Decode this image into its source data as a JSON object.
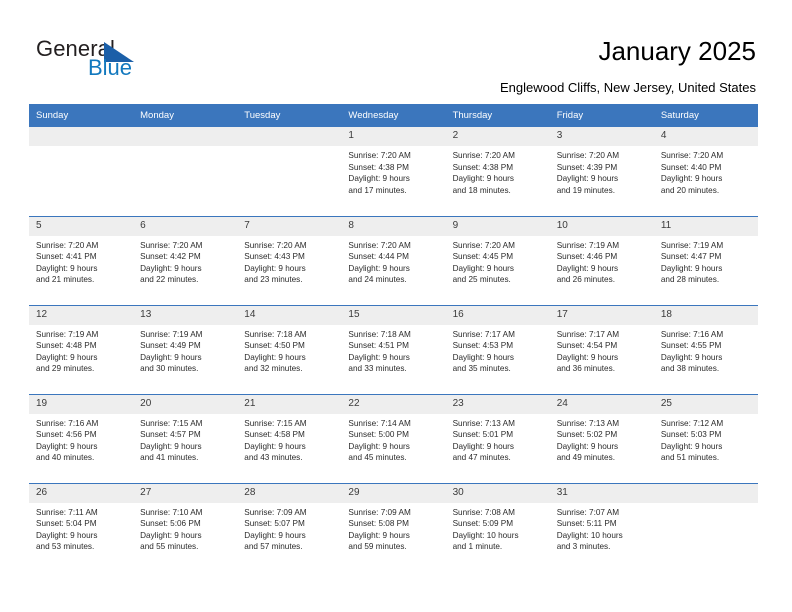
{
  "brand": {
    "name_top": "General",
    "name_bottom": "Blue",
    "accent_blue": "#1278be",
    "triangle_blue": "#1b5fa8"
  },
  "header": {
    "title": "January 2025",
    "subtitle": "Englewood Cliffs, New Jersey, United States"
  },
  "calendar": {
    "header_bg": "#3b76bd",
    "daynum_bg": "#eeeeee",
    "weekday_headers": [
      "Sunday",
      "Monday",
      "Tuesday",
      "Wednesday",
      "Thursday",
      "Friday",
      "Saturday"
    ],
    "labels": {
      "sunrise": "Sunrise:",
      "sunset": "Sunset:",
      "daylight": "Daylight:"
    },
    "weeks": [
      [
        {
          "day": "",
          "empty": true
        },
        {
          "day": "",
          "empty": true
        },
        {
          "day": "",
          "empty": true
        },
        {
          "day": "1",
          "sunrise": "Sunrise: 7:20 AM",
          "sunset": "Sunset: 4:38 PM",
          "daylight_l1": "Daylight: 9 hours",
          "daylight_l2": "and 17 minutes."
        },
        {
          "day": "2",
          "sunrise": "Sunrise: 7:20 AM",
          "sunset": "Sunset: 4:38 PM",
          "daylight_l1": "Daylight: 9 hours",
          "daylight_l2": "and 18 minutes."
        },
        {
          "day": "3",
          "sunrise": "Sunrise: 7:20 AM",
          "sunset": "Sunset: 4:39 PM",
          "daylight_l1": "Daylight: 9 hours",
          "daylight_l2": "and 19 minutes."
        },
        {
          "day": "4",
          "sunrise": "Sunrise: 7:20 AM",
          "sunset": "Sunset: 4:40 PM",
          "daylight_l1": "Daylight: 9 hours",
          "daylight_l2": "and 20 minutes."
        }
      ],
      [
        {
          "day": "5",
          "sunrise": "Sunrise: 7:20 AM",
          "sunset": "Sunset: 4:41 PM",
          "daylight_l1": "Daylight: 9 hours",
          "daylight_l2": "and 21 minutes."
        },
        {
          "day": "6",
          "sunrise": "Sunrise: 7:20 AM",
          "sunset": "Sunset: 4:42 PM",
          "daylight_l1": "Daylight: 9 hours",
          "daylight_l2": "and 22 minutes."
        },
        {
          "day": "7",
          "sunrise": "Sunrise: 7:20 AM",
          "sunset": "Sunset: 4:43 PM",
          "daylight_l1": "Daylight: 9 hours",
          "daylight_l2": "and 23 minutes."
        },
        {
          "day": "8",
          "sunrise": "Sunrise: 7:20 AM",
          "sunset": "Sunset: 4:44 PM",
          "daylight_l1": "Daylight: 9 hours",
          "daylight_l2": "and 24 minutes."
        },
        {
          "day": "9",
          "sunrise": "Sunrise: 7:20 AM",
          "sunset": "Sunset: 4:45 PM",
          "daylight_l1": "Daylight: 9 hours",
          "daylight_l2": "and 25 minutes."
        },
        {
          "day": "10",
          "sunrise": "Sunrise: 7:19 AM",
          "sunset": "Sunset: 4:46 PM",
          "daylight_l1": "Daylight: 9 hours",
          "daylight_l2": "and 26 minutes."
        },
        {
          "day": "11",
          "sunrise": "Sunrise: 7:19 AM",
          "sunset": "Sunset: 4:47 PM",
          "daylight_l1": "Daylight: 9 hours",
          "daylight_l2": "and 28 minutes."
        }
      ],
      [
        {
          "day": "12",
          "sunrise": "Sunrise: 7:19 AM",
          "sunset": "Sunset: 4:48 PM",
          "daylight_l1": "Daylight: 9 hours",
          "daylight_l2": "and 29 minutes."
        },
        {
          "day": "13",
          "sunrise": "Sunrise: 7:19 AM",
          "sunset": "Sunset: 4:49 PM",
          "daylight_l1": "Daylight: 9 hours",
          "daylight_l2": "and 30 minutes."
        },
        {
          "day": "14",
          "sunrise": "Sunrise: 7:18 AM",
          "sunset": "Sunset: 4:50 PM",
          "daylight_l1": "Daylight: 9 hours",
          "daylight_l2": "and 32 minutes."
        },
        {
          "day": "15",
          "sunrise": "Sunrise: 7:18 AM",
          "sunset": "Sunset: 4:51 PM",
          "daylight_l1": "Daylight: 9 hours",
          "daylight_l2": "and 33 minutes."
        },
        {
          "day": "16",
          "sunrise": "Sunrise: 7:17 AM",
          "sunset": "Sunset: 4:53 PM",
          "daylight_l1": "Daylight: 9 hours",
          "daylight_l2": "and 35 minutes."
        },
        {
          "day": "17",
          "sunrise": "Sunrise: 7:17 AM",
          "sunset": "Sunset: 4:54 PM",
          "daylight_l1": "Daylight: 9 hours",
          "daylight_l2": "and 36 minutes."
        },
        {
          "day": "18",
          "sunrise": "Sunrise: 7:16 AM",
          "sunset": "Sunset: 4:55 PM",
          "daylight_l1": "Daylight: 9 hours",
          "daylight_l2": "and 38 minutes."
        }
      ],
      [
        {
          "day": "19",
          "sunrise": "Sunrise: 7:16 AM",
          "sunset": "Sunset: 4:56 PM",
          "daylight_l1": "Daylight: 9 hours",
          "daylight_l2": "and 40 minutes."
        },
        {
          "day": "20",
          "sunrise": "Sunrise: 7:15 AM",
          "sunset": "Sunset: 4:57 PM",
          "daylight_l1": "Daylight: 9 hours",
          "daylight_l2": "and 41 minutes."
        },
        {
          "day": "21",
          "sunrise": "Sunrise: 7:15 AM",
          "sunset": "Sunset: 4:58 PM",
          "daylight_l1": "Daylight: 9 hours",
          "daylight_l2": "and 43 minutes."
        },
        {
          "day": "22",
          "sunrise": "Sunrise: 7:14 AM",
          "sunset": "Sunset: 5:00 PM",
          "daylight_l1": "Daylight: 9 hours",
          "daylight_l2": "and 45 minutes."
        },
        {
          "day": "23",
          "sunrise": "Sunrise: 7:13 AM",
          "sunset": "Sunset: 5:01 PM",
          "daylight_l1": "Daylight: 9 hours",
          "daylight_l2": "and 47 minutes."
        },
        {
          "day": "24",
          "sunrise": "Sunrise: 7:13 AM",
          "sunset": "Sunset: 5:02 PM",
          "daylight_l1": "Daylight: 9 hours",
          "daylight_l2": "and 49 minutes."
        },
        {
          "day": "25",
          "sunrise": "Sunrise: 7:12 AM",
          "sunset": "Sunset: 5:03 PM",
          "daylight_l1": "Daylight: 9 hours",
          "daylight_l2": "and 51 minutes."
        }
      ],
      [
        {
          "day": "26",
          "sunrise": "Sunrise: 7:11 AM",
          "sunset": "Sunset: 5:04 PM",
          "daylight_l1": "Daylight: 9 hours",
          "daylight_l2": "and 53 minutes."
        },
        {
          "day": "27",
          "sunrise": "Sunrise: 7:10 AM",
          "sunset": "Sunset: 5:06 PM",
          "daylight_l1": "Daylight: 9 hours",
          "daylight_l2": "and 55 minutes."
        },
        {
          "day": "28",
          "sunrise": "Sunrise: 7:09 AM",
          "sunset": "Sunset: 5:07 PM",
          "daylight_l1": "Daylight: 9 hours",
          "daylight_l2": "and 57 minutes."
        },
        {
          "day": "29",
          "sunrise": "Sunrise: 7:09 AM",
          "sunset": "Sunset: 5:08 PM",
          "daylight_l1": "Daylight: 9 hours",
          "daylight_l2": "and 59 minutes."
        },
        {
          "day": "30",
          "sunrise": "Sunrise: 7:08 AM",
          "sunset": "Sunset: 5:09 PM",
          "daylight_l1": "Daylight: 10 hours",
          "daylight_l2": "and 1 minute."
        },
        {
          "day": "31",
          "sunrise": "Sunrise: 7:07 AM",
          "sunset": "Sunset: 5:11 PM",
          "daylight_l1": "Daylight: 10 hours",
          "daylight_l2": "and 3 minutes."
        },
        {
          "day": "",
          "empty": true
        }
      ]
    ]
  }
}
